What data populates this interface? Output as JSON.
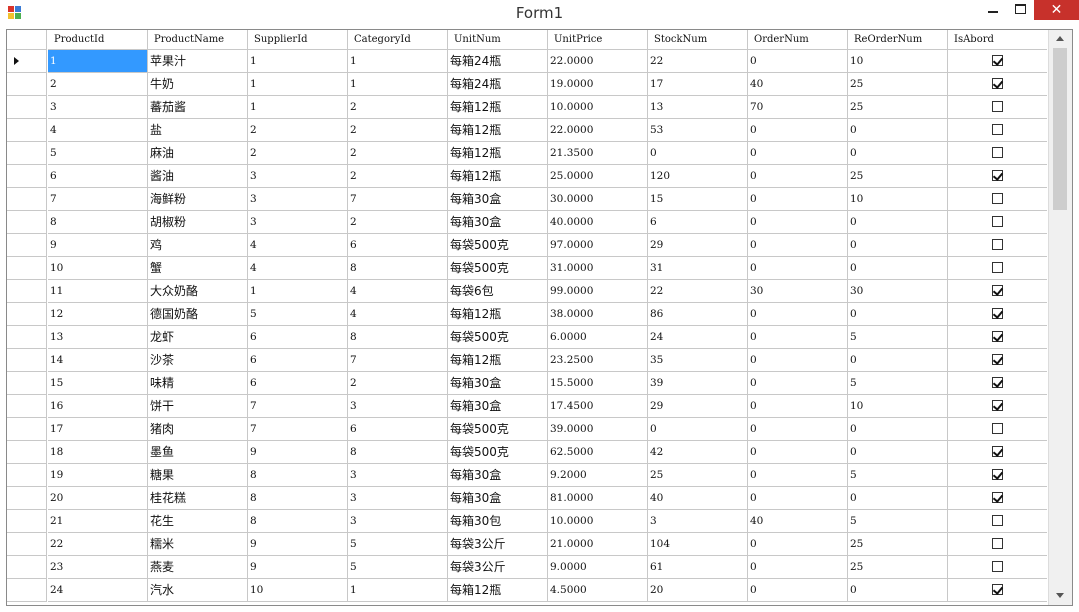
{
  "window": {
    "title": "Form1",
    "close_glyph": "✕",
    "icons": {
      "app": "app-icon",
      "minimize": "minimize-icon",
      "maximize": "maximize-icon",
      "close": "close-icon"
    }
  },
  "grid": {
    "columns": [
      "ProductId",
      "ProductName",
      "SupplierId",
      "CategoryId",
      "UnitNum",
      "UnitPrice",
      "StockNum",
      "OrderNum",
      "ReOrderNum",
      "IsAbord"
    ],
    "current_row_index": 0,
    "selected_cell": {
      "row": 0,
      "col": 0
    },
    "colors": {
      "selection": "#3399ff",
      "gridline": "#c8c8c8",
      "close": "#c7312b"
    },
    "rows": [
      {
        "ProductId": "1",
        "ProductName": "苹果汁",
        "SupplierId": "1",
        "CategoryId": "1",
        "UnitNum": "每箱24瓶",
        "UnitPrice": "22.0000",
        "StockNum": "22",
        "OrderNum": "0",
        "ReOrderNum": "10",
        "IsAbord": true
      },
      {
        "ProductId": "2",
        "ProductName": "牛奶",
        "SupplierId": "1",
        "CategoryId": "1",
        "UnitNum": "每箱24瓶",
        "UnitPrice": "19.0000",
        "StockNum": "17",
        "OrderNum": "40",
        "ReOrderNum": "25",
        "IsAbord": true
      },
      {
        "ProductId": "3",
        "ProductName": "蕃茄酱",
        "SupplierId": "1",
        "CategoryId": "2",
        "UnitNum": "每箱12瓶",
        "UnitPrice": "10.0000",
        "StockNum": "13",
        "OrderNum": "70",
        "ReOrderNum": "25",
        "IsAbord": false
      },
      {
        "ProductId": "4",
        "ProductName": "盐",
        "SupplierId": "2",
        "CategoryId": "2",
        "UnitNum": "每箱12瓶",
        "UnitPrice": "22.0000",
        "StockNum": "53",
        "OrderNum": "0",
        "ReOrderNum": "0",
        "IsAbord": false
      },
      {
        "ProductId": "5",
        "ProductName": "麻油",
        "SupplierId": "2",
        "CategoryId": "2",
        "UnitNum": "每箱12瓶",
        "UnitPrice": "21.3500",
        "StockNum": "0",
        "OrderNum": "0",
        "ReOrderNum": "0",
        "IsAbord": false
      },
      {
        "ProductId": "6",
        "ProductName": "酱油",
        "SupplierId": "3",
        "CategoryId": "2",
        "UnitNum": "每箱12瓶",
        "UnitPrice": "25.0000",
        "StockNum": "120",
        "OrderNum": "0",
        "ReOrderNum": "25",
        "IsAbord": true
      },
      {
        "ProductId": "7",
        "ProductName": "海鲜粉",
        "SupplierId": "3",
        "CategoryId": "7",
        "UnitNum": "每箱30盒",
        "UnitPrice": "30.0000",
        "StockNum": "15",
        "OrderNum": "0",
        "ReOrderNum": "10",
        "IsAbord": false
      },
      {
        "ProductId": "8",
        "ProductName": "胡椒粉",
        "SupplierId": "3",
        "CategoryId": "2",
        "UnitNum": "每箱30盒",
        "UnitPrice": "40.0000",
        "StockNum": "6",
        "OrderNum": "0",
        "ReOrderNum": "0",
        "IsAbord": false
      },
      {
        "ProductId": "9",
        "ProductName": "鸡",
        "SupplierId": "4",
        "CategoryId": "6",
        "UnitNum": "每袋500克",
        "UnitPrice": "97.0000",
        "StockNum": "29",
        "OrderNum": "0",
        "ReOrderNum": "0",
        "IsAbord": false
      },
      {
        "ProductId": "10",
        "ProductName": "蟹",
        "SupplierId": "4",
        "CategoryId": "8",
        "UnitNum": "每袋500克",
        "UnitPrice": "31.0000",
        "StockNum": "31",
        "OrderNum": "0",
        "ReOrderNum": "0",
        "IsAbord": false
      },
      {
        "ProductId": "11",
        "ProductName": "大众奶酪",
        "SupplierId": "1",
        "CategoryId": "4",
        "UnitNum": "每袋6包",
        "UnitPrice": "99.0000",
        "StockNum": "22",
        "OrderNum": "30",
        "ReOrderNum": "30",
        "IsAbord": true
      },
      {
        "ProductId": "12",
        "ProductName": "德国奶酪",
        "SupplierId": "5",
        "CategoryId": "4",
        "UnitNum": "每箱12瓶",
        "UnitPrice": "38.0000",
        "StockNum": "86",
        "OrderNum": "0",
        "ReOrderNum": "0",
        "IsAbord": true
      },
      {
        "ProductId": "13",
        "ProductName": "龙虾",
        "SupplierId": "6",
        "CategoryId": "8",
        "UnitNum": "每袋500克",
        "UnitPrice": "6.0000",
        "StockNum": "24",
        "OrderNum": "0",
        "ReOrderNum": "5",
        "IsAbord": true
      },
      {
        "ProductId": "14",
        "ProductName": "沙茶",
        "SupplierId": "6",
        "CategoryId": "7",
        "UnitNum": "每箱12瓶",
        "UnitPrice": "23.2500",
        "StockNum": "35",
        "OrderNum": "0",
        "ReOrderNum": "0",
        "IsAbord": true
      },
      {
        "ProductId": "15",
        "ProductName": "味精",
        "SupplierId": "6",
        "CategoryId": "2",
        "UnitNum": "每箱30盒",
        "UnitPrice": "15.5000",
        "StockNum": "39",
        "OrderNum": "0",
        "ReOrderNum": "5",
        "IsAbord": true
      },
      {
        "ProductId": "16",
        "ProductName": "饼干",
        "SupplierId": "7",
        "CategoryId": "3",
        "UnitNum": "每箱30盒",
        "UnitPrice": "17.4500",
        "StockNum": "29",
        "OrderNum": "0",
        "ReOrderNum": "10",
        "IsAbord": true
      },
      {
        "ProductId": "17",
        "ProductName": "猪肉",
        "SupplierId": "7",
        "CategoryId": "6",
        "UnitNum": "每袋500克",
        "UnitPrice": "39.0000",
        "StockNum": "0",
        "OrderNum": "0",
        "ReOrderNum": "0",
        "IsAbord": false
      },
      {
        "ProductId": "18",
        "ProductName": "墨鱼",
        "SupplierId": "9",
        "CategoryId": "8",
        "UnitNum": "每袋500克",
        "UnitPrice": "62.5000",
        "StockNum": "42",
        "OrderNum": "0",
        "ReOrderNum": "0",
        "IsAbord": true
      },
      {
        "ProductId": "19",
        "ProductName": "糖果",
        "SupplierId": "8",
        "CategoryId": "3",
        "UnitNum": "每箱30盒",
        "UnitPrice": "9.2000",
        "StockNum": "25",
        "OrderNum": "0",
        "ReOrderNum": "5",
        "IsAbord": true
      },
      {
        "ProductId": "20",
        "ProductName": "桂花糕",
        "SupplierId": "8",
        "CategoryId": "3",
        "UnitNum": "每箱30盒",
        "UnitPrice": "81.0000",
        "StockNum": "40",
        "OrderNum": "0",
        "ReOrderNum": "0",
        "IsAbord": true
      },
      {
        "ProductId": "21",
        "ProductName": "花生",
        "SupplierId": "8",
        "CategoryId": "3",
        "UnitNum": "每箱30包",
        "UnitPrice": "10.0000",
        "StockNum": "3",
        "OrderNum": "40",
        "ReOrderNum": "5",
        "IsAbord": false
      },
      {
        "ProductId": "22",
        "ProductName": "糯米",
        "SupplierId": "9",
        "CategoryId": "5",
        "UnitNum": "每袋3公斤",
        "UnitPrice": "21.0000",
        "StockNum": "104",
        "OrderNum": "0",
        "ReOrderNum": "25",
        "IsAbord": false
      },
      {
        "ProductId": "23",
        "ProductName": "燕麦",
        "SupplierId": "9",
        "CategoryId": "5",
        "UnitNum": "每袋3公斤",
        "UnitPrice": "9.0000",
        "StockNum": "61",
        "OrderNum": "0",
        "ReOrderNum": "25",
        "IsAbord": false
      },
      {
        "ProductId": "24",
        "ProductName": "汽水",
        "SupplierId": "10",
        "CategoryId": "1",
        "UnitNum": "每箱12瓶",
        "UnitPrice": "4.5000",
        "StockNum": "20",
        "OrderNum": "0",
        "ReOrderNum": "0",
        "IsAbord": true
      }
    ]
  }
}
